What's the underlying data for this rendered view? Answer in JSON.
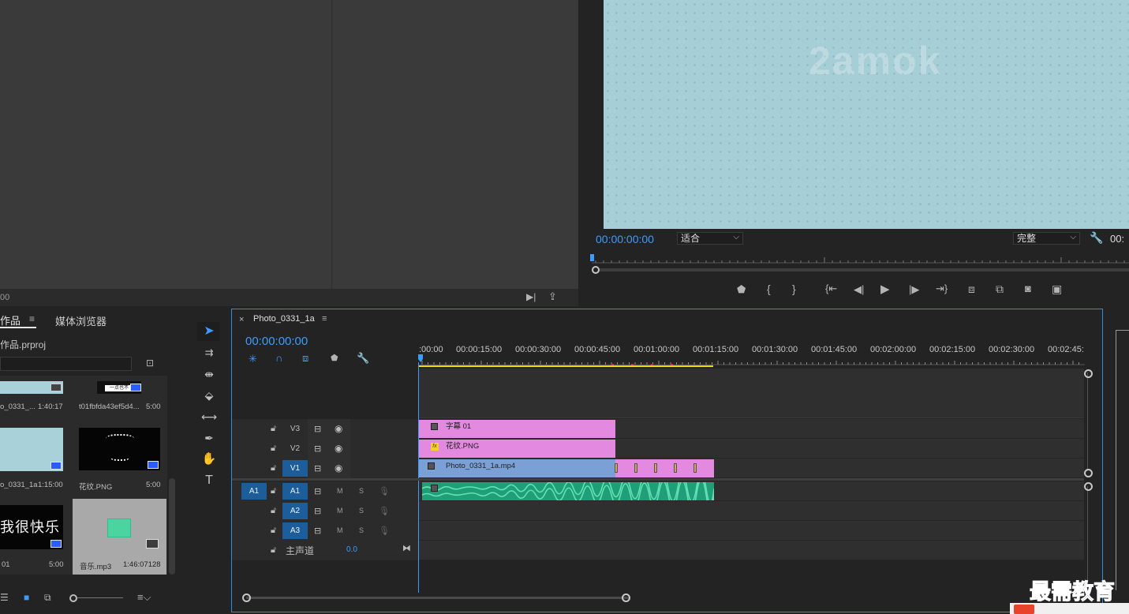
{
  "source": {
    "timecode": "00",
    "footer_icons": [
      "export-frame-icon",
      "share-icon"
    ]
  },
  "program": {
    "watermark": "2amok",
    "timecode": "00:00:00:00",
    "fit_select": "适合",
    "quality_select": "完整",
    "right_timecode": "00:",
    "transport_icons": [
      "add-marker",
      "mark-in",
      "mark-out",
      "go-to-in",
      "step-back",
      "play",
      "step-forward",
      "go-to-out",
      "lift",
      "extract",
      "export-frame",
      "compare"
    ]
  },
  "project": {
    "tab_label": "作品",
    "browser_tab": "媒体浏览器",
    "file_name": "作品.prproj",
    "items": [
      {
        "name": "o_0331_...",
        "duration": "1:40:17"
      },
      {
        "name": "t01fbfda43ef5d4...",
        "duration": "5:00"
      },
      {
        "name": "o_0331_1a",
        "duration": "1:15:00"
      },
      {
        "name": "花纹.PNG",
        "duration": "5:00"
      },
      {
        "name": "01",
        "duration": "5:00",
        "text": "我很快乐"
      },
      {
        "name": "音乐.mp3",
        "duration": "1:46:07128"
      }
    ],
    "thumb_caption": "一点也不"
  },
  "timeline": {
    "tab_name": "Photo_0331_1a",
    "timecode": "00:00:00:00",
    "ruler": [
      ":00:00",
      "00:00:15:00",
      "00:00:30:00",
      "00:00:45:00",
      "00:01:00:00",
      "00:01:15:00",
      "00:01:30:00",
      "00:01:45:00",
      "00:02:00:00",
      "00:02:15:00",
      "00:02:30:00",
      "00:02:45:"
    ],
    "video_tracks": [
      "V3",
      "V2",
      "V1"
    ],
    "audio_tracks": [
      "A1",
      "A2",
      "A3"
    ],
    "source_target": "A1",
    "mute_label": "M",
    "solo_label": "S",
    "master_label": "主声道",
    "master_value": "0.0",
    "clips": {
      "v3": "字幕 01",
      "v2": "花纹.PNG",
      "v1": "Photo_0331_1a.mp4"
    },
    "fx_label": "fx"
  },
  "logo": "最需教育",
  "colors": {
    "accent": "#2c8ee0",
    "timecode": "#3d9bff",
    "clip_pink": "#e38ae0",
    "clip_blue": "#7aa0d6",
    "clip_audio": "#1f9f78"
  }
}
